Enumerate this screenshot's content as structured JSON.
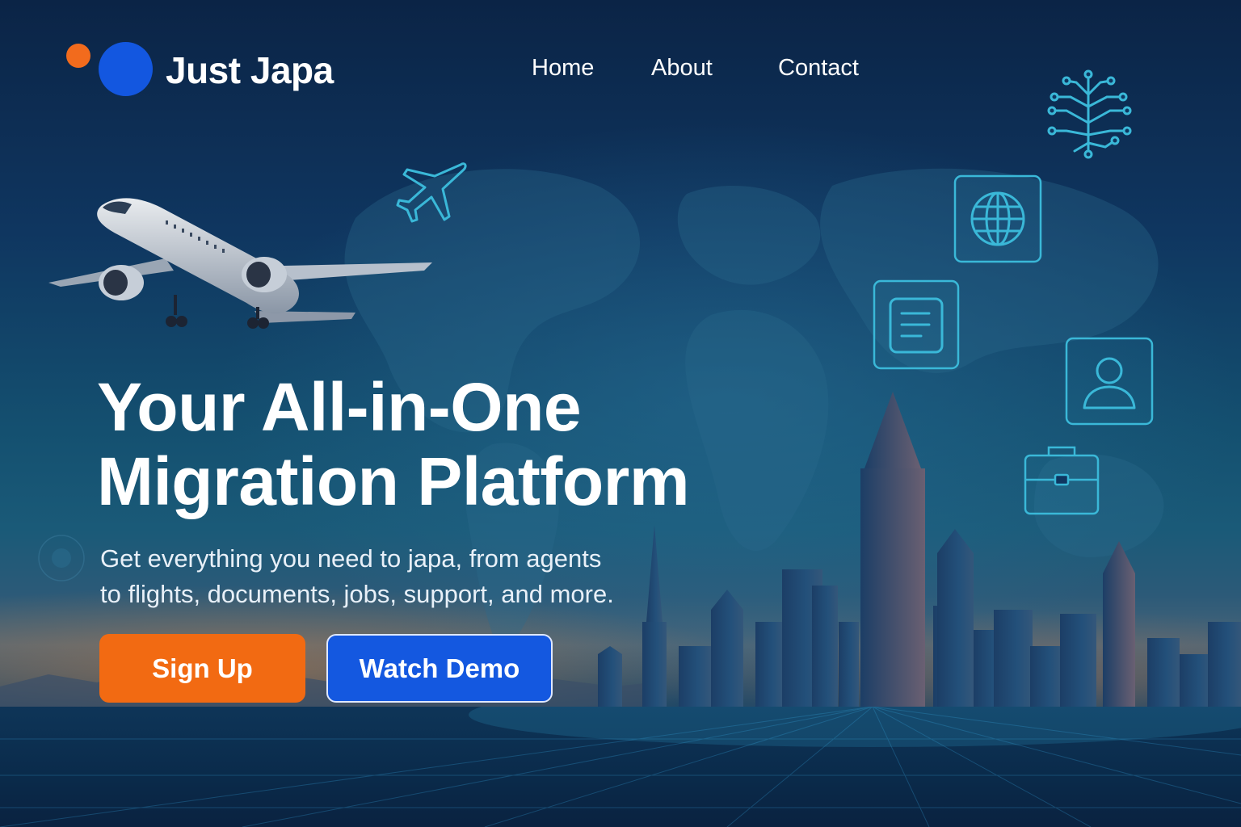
{
  "brand": {
    "name": "Just Japa",
    "colors": {
      "orange": "#f26b1d",
      "blue": "#1357e0"
    }
  },
  "nav": {
    "items": [
      {
        "label": "Home"
      },
      {
        "label": "About"
      },
      {
        "label": "Contact"
      }
    ]
  },
  "hero": {
    "title_line1": "Your All-in-One",
    "title_line2": "Migration Platform",
    "subtitle_line1": "Get everything you need to japa, from agents",
    "subtitle_line2": "to flights, documents, jobs, support, and more.",
    "primary_button": "Sign Up",
    "secondary_button": "Watch Demo"
  },
  "icons": [
    "airplane-outline-icon",
    "network-tree-icon",
    "globe-icon",
    "document-icon",
    "user-profile-icon",
    "briefcase-icon"
  ],
  "colors": {
    "accent_orange": "#f26a12",
    "accent_blue": "#1458e0",
    "icon_cyan": "#3ab8d8",
    "background_navy": "#0d2747"
  }
}
